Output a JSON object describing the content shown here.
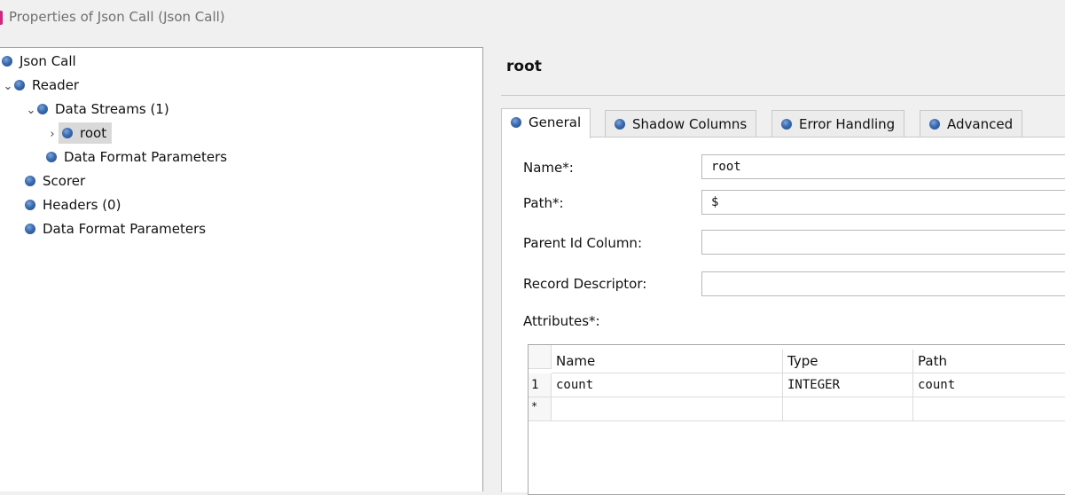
{
  "window": {
    "title": "Properties of Json Call (Json Call)"
  },
  "tree": {
    "items": [
      {
        "label": "Json Call"
      },
      {
        "label": "Reader",
        "chevron": "expanded"
      },
      {
        "label": "Data Streams (1)",
        "chevron": "expanded"
      },
      {
        "label": "root",
        "chevron": "collapsed",
        "selected": true
      },
      {
        "label": "Data Format Parameters"
      },
      {
        "label": "Scorer"
      },
      {
        "label": "Headers (0)"
      },
      {
        "label": "Data Format Parameters"
      }
    ],
    "chevron_expanded": "⌄",
    "chevron_collapsed": "›"
  },
  "panel": {
    "title": "root",
    "tabs": [
      {
        "label": "General",
        "active": true
      },
      {
        "label": "Shadow Columns"
      },
      {
        "label": "Error Handling"
      },
      {
        "label": "Advanced"
      }
    ],
    "form": {
      "name_label": "Name*:",
      "name_value": "root",
      "path_label": "Path*:",
      "path_value": "$",
      "parent_id_label": "Parent Id Column:",
      "parent_id_value": "",
      "record_desc_label": "Record Descriptor:",
      "record_desc_value": "",
      "attributes_label": "Attributes*:"
    },
    "attributes_table": {
      "columns": [
        "Name",
        "Type",
        "Path"
      ],
      "rows": [
        {
          "num": "1",
          "name": "count",
          "type": "INTEGER",
          "path": "count"
        }
      ],
      "new_row_marker": "*"
    }
  },
  "colors": {
    "icon_ball": "#2f5fa5",
    "title_icon": "#d0287a",
    "selection": "#d9d9d9"
  }
}
